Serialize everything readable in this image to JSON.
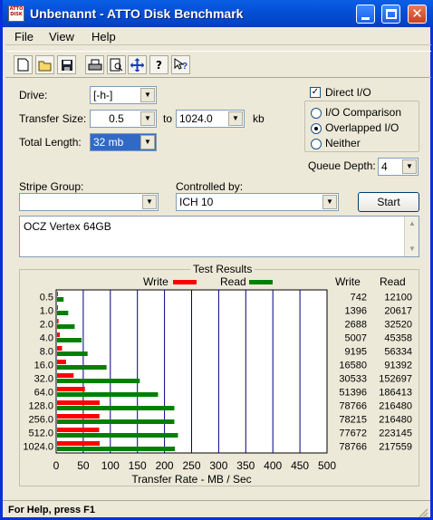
{
  "window": {
    "title": "Unbenannt - ATTO Disk Benchmark",
    "icon_text": "ATTO DISK"
  },
  "menu": [
    "File",
    "View",
    "Help"
  ],
  "toolbar_icons": [
    "new-icon",
    "open-icon",
    "save-icon",
    "print-icon",
    "print-preview-icon",
    "move-icon",
    "help-icon",
    "context-help-icon"
  ],
  "form": {
    "drive_label": "Drive:",
    "drive_value": "[-h-]",
    "transfer_size_label": "Transfer Size:",
    "transfer_from": "0.5",
    "to_label": "to",
    "transfer_to": "1024.0",
    "kb_label": "kb",
    "total_length_label": "Total Length:",
    "total_length_value": "32 mb",
    "direct_io_label": "Direct I/O",
    "io_comparison_label": "I/O Comparison",
    "overlapped_io_label": "Overlapped I/O",
    "neither_label": "Neither",
    "queue_depth_label": "Queue Depth:",
    "queue_depth_value": "4",
    "stripe_group_label": "Stripe Group:",
    "stripe_group_value": "",
    "controlled_by_label": "Controlled by:",
    "controlled_by_value": "ICH 10",
    "start_button": "Start",
    "description": "OCZ Vertex 64GB"
  },
  "results": {
    "title": "Test Results",
    "write_legend": "Write",
    "read_legend": "Read",
    "write_col_header": "Write",
    "read_col_header": "Read",
    "write_color": "#ff0000",
    "read_color": "#008000"
  },
  "status": {
    "text": "For Help, press F1"
  },
  "chart_data": {
    "type": "bar",
    "orientation": "horizontal",
    "categories": [
      "0.5",
      "1.0",
      "2.0",
      "4.0",
      "8.0",
      "16.0",
      "32.0",
      "64.0",
      "128.0",
      "256.0",
      "512.0",
      "1024.0"
    ],
    "series": [
      {
        "name": "Write",
        "values": [
          742,
          1396,
          2688,
          5007,
          9195,
          16580,
          30533,
          51396,
          78766,
          78215,
          77672,
          78766
        ]
      },
      {
        "name": "Read",
        "values": [
          12100,
          20617,
          32520,
          45358,
          56334,
          91392,
          152697,
          186413,
          216480,
          216480,
          223145,
          217559
        ]
      }
    ],
    "xlabel": "Transfer Rate - MB / Sec",
    "xticks": [
      "0",
      "50",
      "100",
      "150",
      "200",
      "250",
      "300",
      "350",
      "400",
      "450",
      "500"
    ],
    "xlim": [
      0,
      500
    ],
    "value_unit_divisor": 1000,
    "grid": true
  }
}
